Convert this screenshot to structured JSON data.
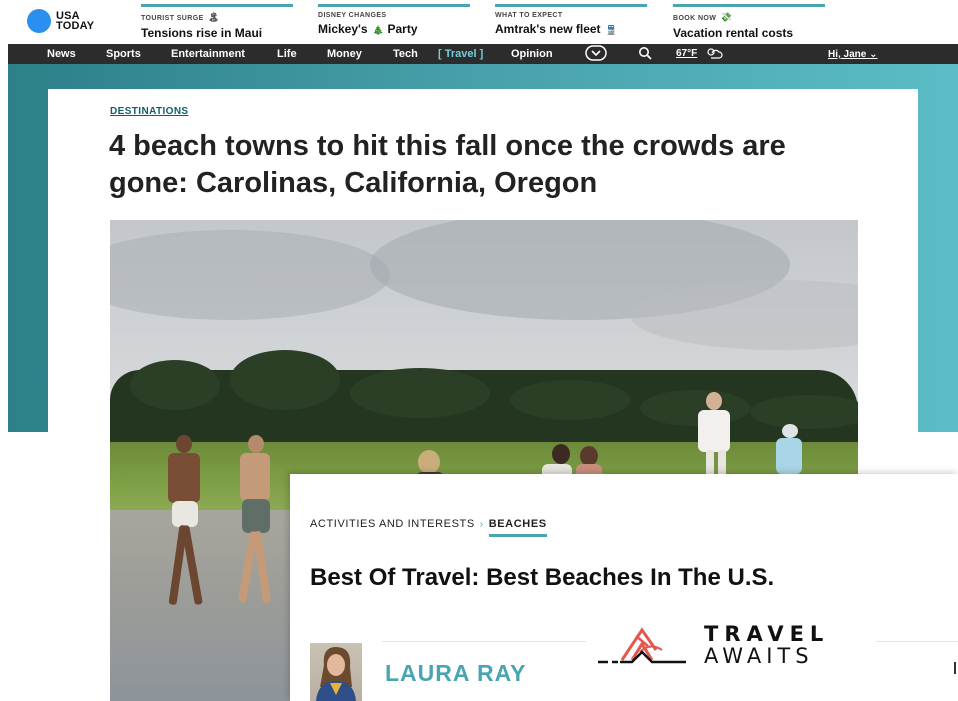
{
  "brand": {
    "line1": "USA",
    "line2": "TODAY"
  },
  "ticker": [
    {
      "kicker": "TOURIST SURGE",
      "headline": "Tensions rise in Maui",
      "emoji": "🏝"
    },
    {
      "kicker": "DISNEY CHANGES",
      "headline": "Mickey's",
      "tail": "Party",
      "emoji": "🎄"
    },
    {
      "kicker": "WHAT TO EXPECT",
      "headline": "Amtrak's new fleet",
      "emoji": "🚆"
    },
    {
      "kicker": "BOOK NOW",
      "headline": "Vacation rental costs",
      "emoji": "💸"
    }
  ],
  "nav": {
    "items": [
      "News",
      "Sports",
      "Entertainment",
      "Life",
      "Money",
      "Tech",
      "[ Travel ]",
      "Opinion"
    ],
    "weather": "67°F",
    "user": "Hi, Jane"
  },
  "article": {
    "section": "DESTINATIONS",
    "title": "4 beach towns to hit this fall once the crowds are gone: Carolinas, California, Oregon"
  },
  "overlay": {
    "breadcrumb_parent": "ACTIVITIES AND INTERESTS",
    "breadcrumb_sep": "›",
    "breadcrumb_current": "BEACHES",
    "title": "Best Of Travel: Best Beaches In The U.S.",
    "author": "LAURA RAY",
    "logo_line1": "TRAVEL",
    "logo_line2": "AWAITS"
  },
  "colors": {
    "accent": "#4aa5b0",
    "brand_blue": "#2b8ff0",
    "nav_bg": "#2c2c2c"
  }
}
